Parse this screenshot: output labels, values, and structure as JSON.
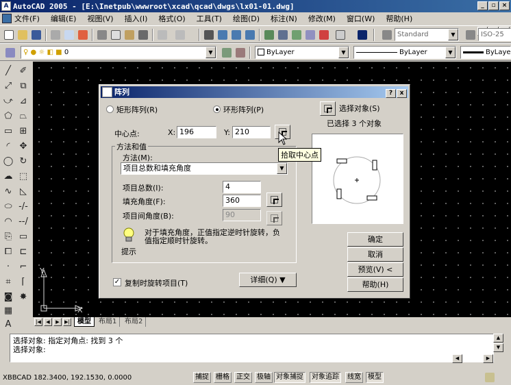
{
  "window": {
    "title": "AutoCAD 2005 - [E:\\Inetpub\\wwwroot\\xcad\\qcad\\dwgs\\lx01-01.dwg]",
    "app_icon": "autocad-icon",
    "controls": [
      "_",
      "8",
      "x"
    ]
  },
  "menu": {
    "items": [
      "文件(F)",
      "编辑(E)",
      "视图(V)",
      "插入(I)",
      "格式(O)",
      "工具(T)",
      "绘图(D)",
      "标注(N)",
      "修改(M)",
      "窗口(W)",
      "帮助(H)"
    ]
  },
  "toolbar": {
    "text_style": "Standard",
    "dim_style": "ISO-25"
  },
  "layers": {
    "current_layer": "0",
    "color": "ByLayer",
    "linetype": "ByLayer",
    "lineweight": "ByLayer"
  },
  "layout_tabs": {
    "tabs": [
      "模型",
      "布局1",
      "布局2"
    ],
    "active": "模型"
  },
  "ucs": {
    "x_label": "X",
    "y_label": "Y"
  },
  "command": {
    "lines": [
      "选择对象: 指定对角点: 找到 3 个",
      "选择对象:"
    ]
  },
  "status": {
    "coords": "XBBCAD  182.3400,  192.1530,  0.0000",
    "toggles": [
      "捕捉",
      "栅格",
      "正交",
      "极轴",
      "对象捕捉",
      "对象追踪",
      "线宽",
      "模型"
    ]
  },
  "dialog": {
    "title": "阵列",
    "help_btn": "?",
    "close_btn": "x",
    "rect_array_label": "矩形阵列(R)",
    "polar_array_label": "环形阵列(P)",
    "array_type_selected": "polar",
    "select_objects_label": "选择对象(S)",
    "selected_count_text": "已选择 3 个对象",
    "center_label": "中心点:",
    "x_label": "X:",
    "x_value": "196",
    "y_label": "Y:",
    "y_value": "210",
    "tooltip": "拾取中心点",
    "method_group_label": "方法和值",
    "method_label": "方法(M):",
    "method_value": "项目总数和填充角度",
    "total_items_label": "项目总数(I):",
    "total_items_value": "4",
    "fill_angle_label": "填充角度(F):",
    "fill_angle_value": "360",
    "angle_between_label": "项目间角度(B):",
    "angle_between_value": "90",
    "tip_text_1": "对于填充角度，正值指定逆时针旋转，负",
    "tip_text_2": "值指定顺时针旋转。",
    "tip_label": "提示",
    "rotate_items_label": "复制时旋转项目(T)",
    "rotate_items_checked": true,
    "details_label": "详细(Q) ▼",
    "ok_label": "确定",
    "cancel_label": "取消",
    "preview_label": "预览(V) <",
    "help_label": "帮助(H)"
  }
}
